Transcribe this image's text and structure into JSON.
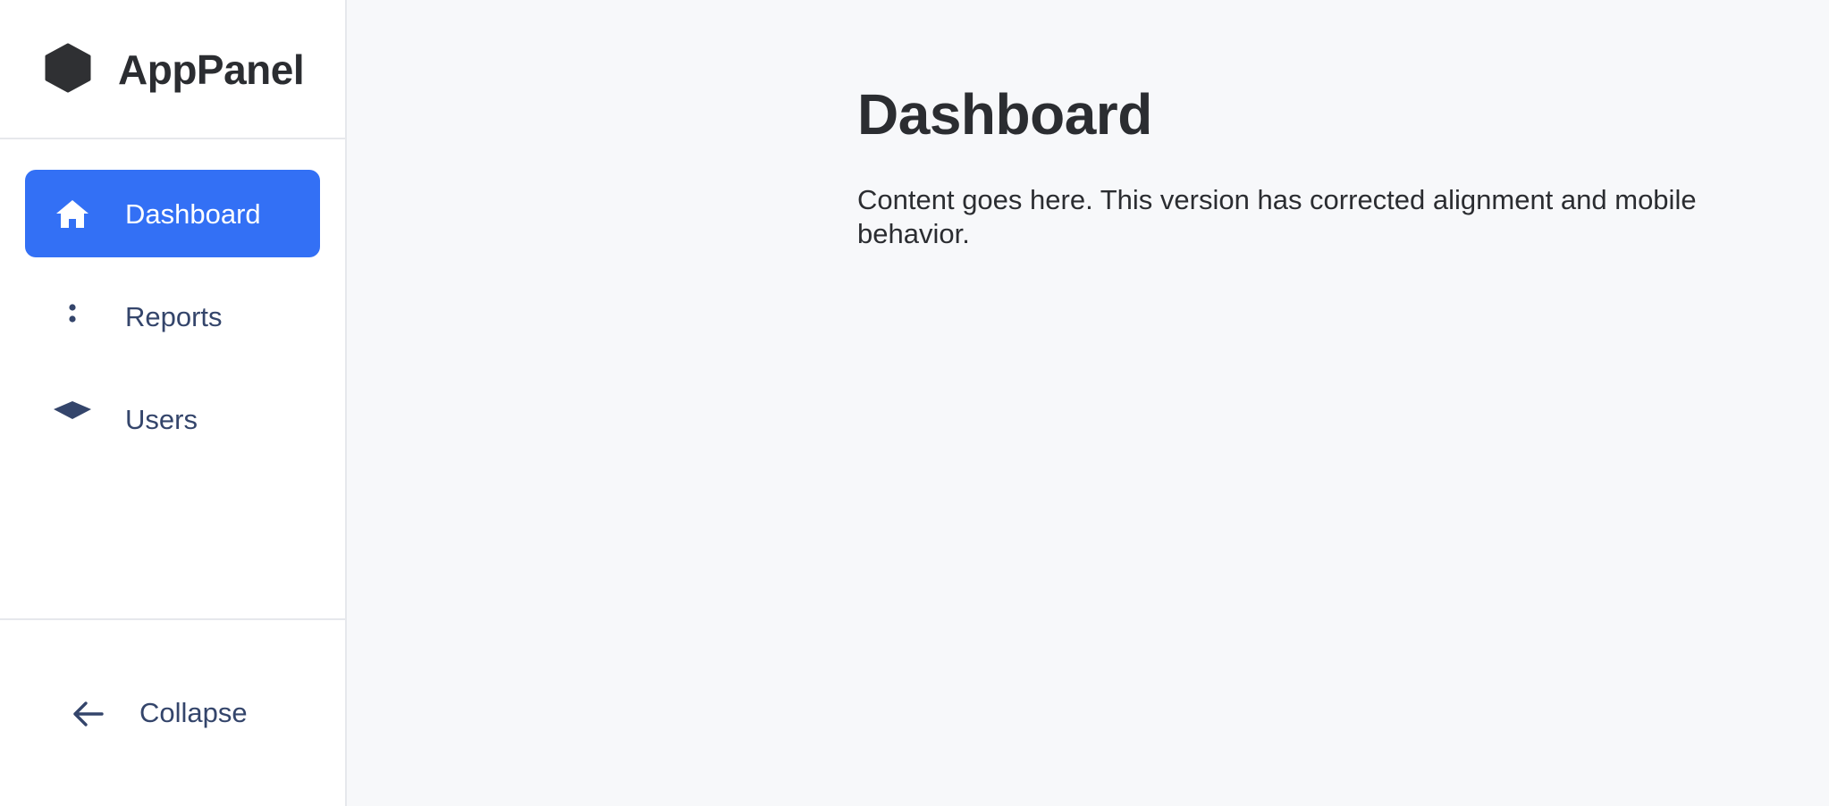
{
  "brand": {
    "name": "AppPanel",
    "logo_icon": "hexagon-icon"
  },
  "sidebar": {
    "items": [
      {
        "label": "Dashboard",
        "icon": "home-icon",
        "active": true
      },
      {
        "label": "Reports",
        "icon": "dots-icon",
        "active": false
      },
      {
        "label": "Users",
        "icon": "diamond-icon",
        "active": false
      }
    ],
    "collapse": {
      "label": "Collapse",
      "icon": "arrow-left-icon"
    }
  },
  "main": {
    "title": "Dashboard",
    "body": "Content goes here. This version has corrected alignment and mobile behavior."
  },
  "colors": {
    "accent": "#3370f5",
    "nav_text": "#34456b",
    "heading": "#2b2d31",
    "background": "#f7f8fa",
    "sidebar_bg": "#ffffff"
  }
}
